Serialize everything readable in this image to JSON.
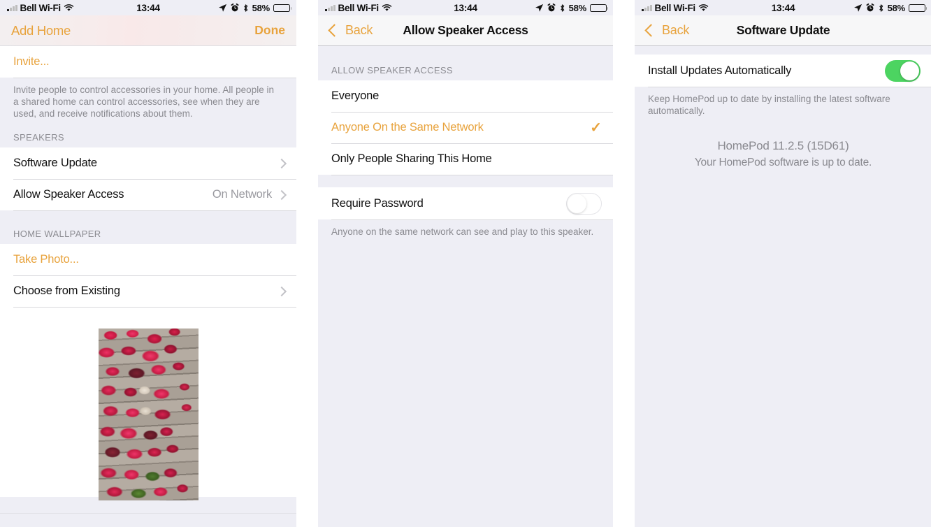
{
  "status_bar": {
    "carrier": "Bell Wi-Fi",
    "time": "13:44",
    "battery_percent": "58%",
    "icons": [
      "signal-bars-icon",
      "wifi-icon",
      "location-arrow-icon",
      "alarm-clock-icon",
      "bluetooth-icon",
      "battery-icon"
    ]
  },
  "colors": {
    "accent": "#e8a33d",
    "toggle_on": "#4cd461",
    "group_bg": "#eeeef5",
    "row_bg": "#ffffff",
    "secondary_text": "#8a8a90"
  },
  "screen1": {
    "nav": {
      "title": "Add Home",
      "done_label": "Done"
    },
    "rows": {
      "invite": "Invite...",
      "software_update": "Software Update",
      "allow_speaker_access": "Allow Speaker Access",
      "allow_speaker_access_value": "On Network",
      "take_photo": "Take Photo...",
      "choose_existing": "Choose from Existing"
    },
    "invite_note": "Invite people to control accessories in your home. All people in a shared home can control accessories, see when they are used, and receive notifications about them.",
    "sections": {
      "speakers": "SPEAKERS",
      "home_wallpaper": "HOME WALLPAPER"
    },
    "wallpaper_alt": "red-vine-leaves-photo"
  },
  "screen2": {
    "nav": {
      "back_label": "Back",
      "title": "Allow Speaker Access"
    },
    "section_header": "ALLOW SPEAKER ACCESS",
    "options": [
      {
        "label": "Everyone",
        "selected": false
      },
      {
        "label": "Anyone On the Same Network",
        "selected": true
      },
      {
        "label": "Only People Sharing This Home",
        "selected": false
      }
    ],
    "require_password": {
      "label": "Require Password",
      "state": "off"
    },
    "footer_note": "Anyone on the same network can see and play to this speaker."
  },
  "screen3": {
    "nav": {
      "back_label": "Back",
      "title": "Software Update"
    },
    "install_auto": {
      "label": "Install Updates Automatically",
      "state": "on"
    },
    "footer_note": "Keep HomePod up to date by installing the latest software automatically.",
    "version_title": "HomePod 11.2.5 (15D61)",
    "version_status": "Your HomePod software is up to date."
  }
}
